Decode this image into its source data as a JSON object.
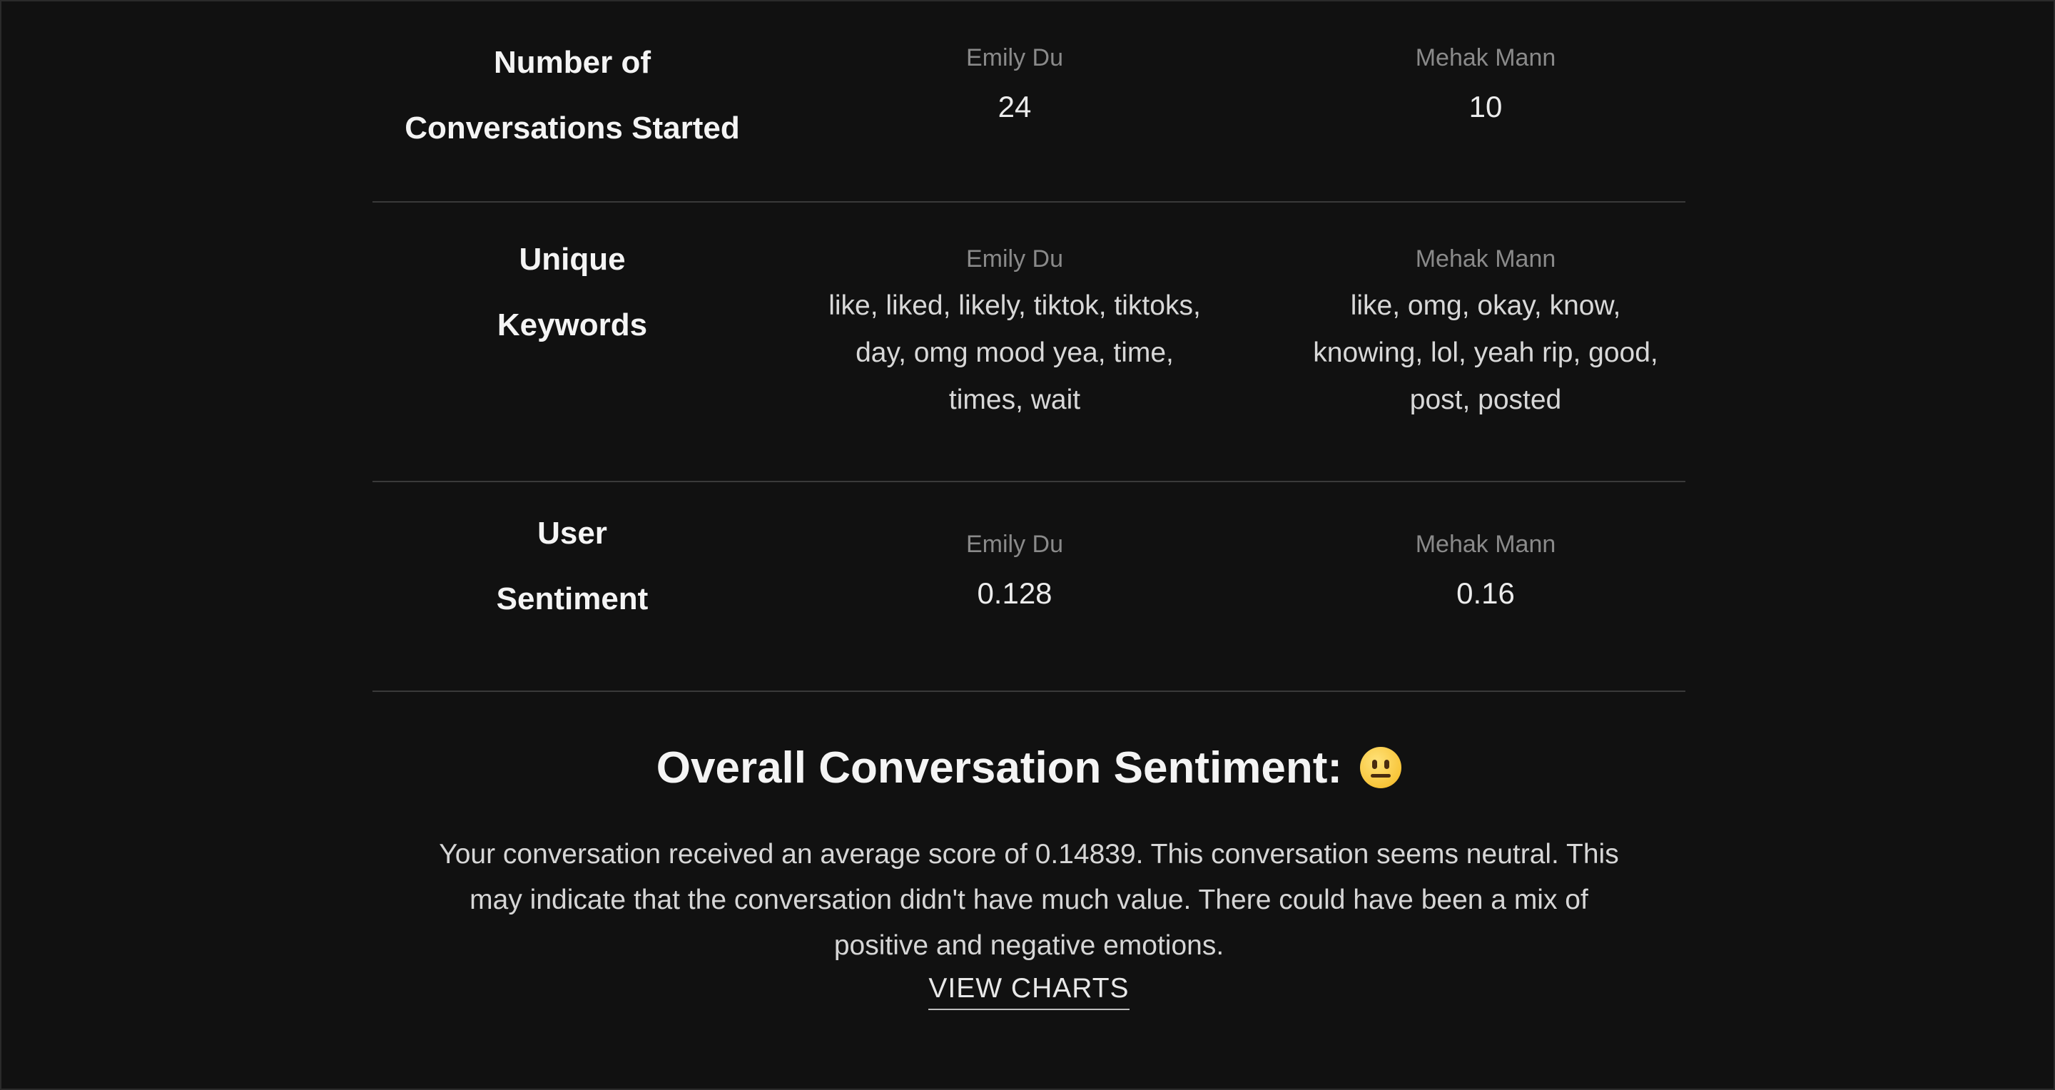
{
  "rows": [
    {
      "label_lines": [
        "Number of",
        "Conversations Started"
      ],
      "users": [
        {
          "name": "Emily Du",
          "value": "24"
        },
        {
          "name": "Mehak Mann",
          "value": "10"
        }
      ]
    },
    {
      "label_lines": [
        "Unique",
        "Keywords"
      ],
      "users": [
        {
          "name": "Emily Du",
          "value_lines": [
            "like, liked, likely, tiktok, tiktoks,",
            "day, omg mood yea, time,",
            "times, wait"
          ]
        },
        {
          "name": "Mehak Mann",
          "value_lines": [
            "like, omg, okay, know,",
            "knowing, lol, yeah rip, good,",
            "post, posted"
          ]
        }
      ]
    },
    {
      "label_lines": [
        "User",
        "Sentiment"
      ],
      "users": [
        {
          "name": "Emily Du",
          "value": "0.128"
        },
        {
          "name": "Mehak Mann",
          "value": "0.16"
        }
      ]
    }
  ],
  "summary": {
    "title": "Overall Conversation Sentiment:",
    "emoji_icon": "neutral-face-emoji",
    "lines": [
      "Your conversation received an average score of 0.14839. This conversation seems neutral. This",
      "may indicate that the conversation didn't have much value. There could have been a mix of",
      "positive and negative emotions."
    ],
    "view_charts_label": "VIEW CHARTS"
  }
}
